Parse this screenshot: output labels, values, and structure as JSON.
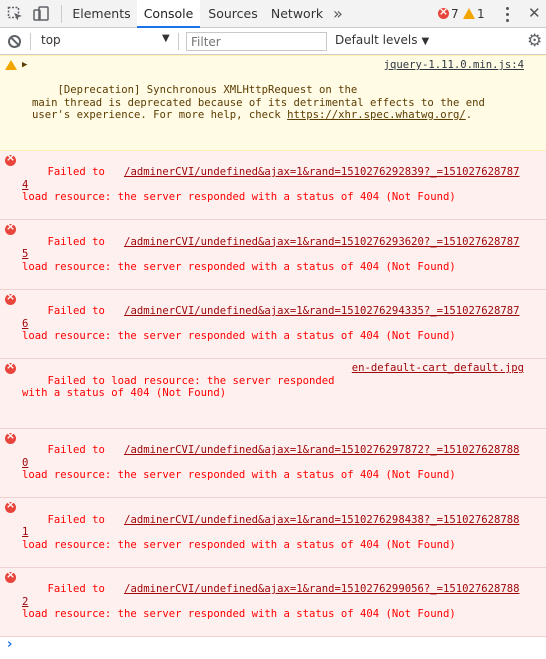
{
  "tabs": [
    {
      "label": "Elements"
    },
    {
      "label": "Console"
    },
    {
      "label": "Sources"
    },
    {
      "label": "Network"
    }
  ],
  "counts": {
    "errors": "7",
    "warnings": "1"
  },
  "toolbar": {
    "context": "top",
    "filter_placeholder": "Filter",
    "levels": "Default levels"
  },
  "messages": [
    {
      "type": "warning",
      "text": "[Deprecation] Synchronous XMLHttpRequest on the\nmain thread is deprecated because of its detrimental effects to the end\nuser's experience. For more help, check ",
      "link": "https://xhr.spec.whatwg.org/",
      "tail": ".",
      "source": "jquery-1.11.0.min.js:4"
    },
    {
      "type": "error",
      "a": "Failed to   ",
      "url": "/adminerCVI/undefined&ajax=1&rand=1510276292839?_=1510276287874",
      "b": "\nload resource: the server responded with a status of 404 (Not Found)"
    },
    {
      "type": "error",
      "a": "Failed to   ",
      "url": "/adminerCVI/undefined&ajax=1&rand=1510276293620?_=1510276287875",
      "b": "\nload resource: the server responded with a status of 404 (Not Found)"
    },
    {
      "type": "error",
      "a": "Failed to   ",
      "url": "/adminerCVI/undefined&ajax=1&rand=1510276294335?_=1510276287876",
      "b": "\nload resource: the server responded with a status of 404 (Not Found)"
    },
    {
      "type": "error",
      "a": "Failed to load resource: the server responded",
      "b": "\nwith a status of 404 (Not Found)",
      "source": "en-default-cart_default.jpg"
    },
    {
      "type": "error",
      "a": "Failed to   ",
      "url": "/adminerCVI/undefined&ajax=1&rand=1510276297872?_=1510276287880",
      "b": "\nload resource: the server responded with a status of 404 (Not Found)"
    },
    {
      "type": "error",
      "a": "Failed to   ",
      "url": "/adminerCVI/undefined&ajax=1&rand=1510276298438?_=1510276287881",
      "b": "\nload resource: the server responded with a status of 404 (Not Found)"
    },
    {
      "type": "error",
      "a": "Failed to   ",
      "url": "/adminerCVI/undefined&ajax=1&rand=1510276299056?_=1510276287882",
      "b": "\nload resource: the server responded with a status of 404 (Not Found)"
    }
  ]
}
